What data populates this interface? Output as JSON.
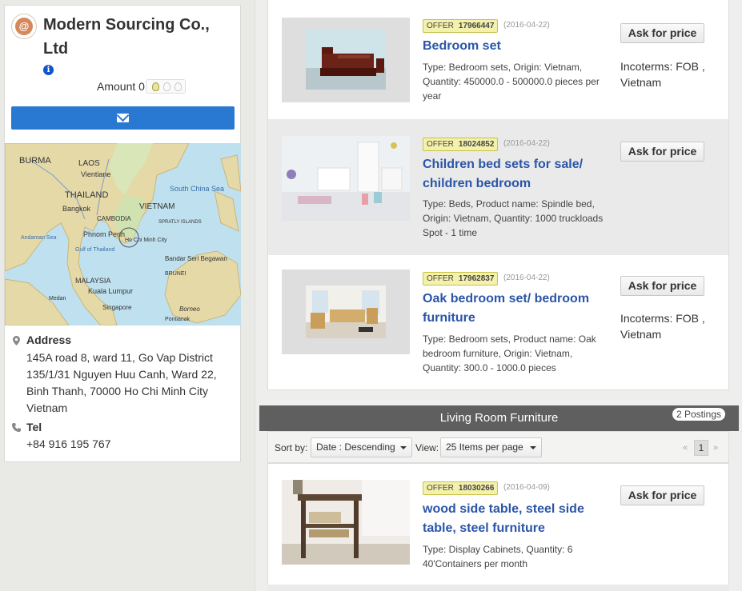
{
  "company": {
    "logo_letter": "@",
    "name": "Modern Sourcing Co., Ltd",
    "info_icon": "i",
    "amount_label": "Amount 0",
    "map_labels": [
      "BURMA",
      "LAOS",
      "Vientiane",
      "THAILAND",
      "Bangkok",
      "CAMBODIA",
      "Phnom Penh",
      "VIETNAM",
      "Ho Chi Minh City",
      "South China Sea",
      "SPRATLY ISLANDS",
      "Gulf of Thailand",
      "Andaman Sea",
      "MALAYSIA",
      "Kuala Lumpur",
      "Singapore",
      "Bandar Seri Begawan",
      "BRUNEI",
      "Borneo",
      "Pontianak",
      "Medan"
    ],
    "address_title": "Address",
    "address_lines": [
      "145A road 8, ward 11, Go Vap District",
      "135/1/31 Nguyen Huu Canh, Ward 22,",
      "Binh Thanh, 70000 Ho Chi Minh City",
      "Vietnam"
    ],
    "tel_title": "Tel",
    "tel_value": "+84 916 195 767"
  },
  "products": [
    {
      "offer_label": "OFFER",
      "offer_id": "17966447",
      "date": "(2016-04-22)",
      "title_lines": [
        "Bedroom set"
      ],
      "desc_lines": [
        "Type: Bedroom sets, Origin: Vietnam,",
        "Quantity: 450000.0 - 500000.0 pieces per",
        "year"
      ],
      "button": "Ask for price",
      "incoterms_lines": [
        "Incoterms: FOB ,",
        "Vietnam"
      ]
    },
    {
      "offer_label": "OFFER",
      "offer_id": "18024852",
      "date": "(2016-04-22)",
      "title_lines": [
        "Children bed sets for sale/",
        "children bedroom"
      ],
      "desc_lines": [
        "Type: Beds, Product name: Spindle bed,",
        "Origin: Vietnam, Quantity: 1000 truckloads",
        "Spot - 1 time"
      ],
      "button": "Ask for price",
      "incoterms_lines": []
    },
    {
      "offer_label": "OFFER",
      "offer_id": "17962837",
      "date": "(2016-04-22)",
      "title_lines": [
        "Oak bedroom set/ bedroom",
        "furniture"
      ],
      "desc_lines": [
        "Type: Bedroom sets, Product name: Oak",
        "bedroom furniture, Origin: Vietnam,",
        "Quantity: 300.0 - 1000.0 pieces"
      ],
      "button": "Ask for price",
      "incoterms_lines": [
        "Incoterms: FOB ,",
        "Vietnam"
      ]
    }
  ],
  "section": {
    "title": "Living Room Furniture",
    "postings": "2 Postings",
    "sort_label": "Sort by:",
    "sort_value": "Date : Descending",
    "view_label": "View:",
    "view_value": "25 Items per page",
    "page_prev": "«",
    "page_current": "1",
    "page_next": "»"
  },
  "living_products": [
    {
      "offer_label": "OFFER",
      "offer_id": "18030266",
      "date": "(2016-04-09)",
      "title_lines": [
        "wood side table, steel side",
        "table, steel furniture"
      ],
      "desc_lines": [
        "Type: Display Cabinets, Quantity: 6",
        "40'Containers per month"
      ],
      "button": "Ask for price"
    }
  ],
  "colors": {
    "link_blue": "#2a55a8",
    "mail_button": "#2979d2",
    "offer_bg": "#f4f1ac",
    "section_header": "#5f5f5f"
  }
}
